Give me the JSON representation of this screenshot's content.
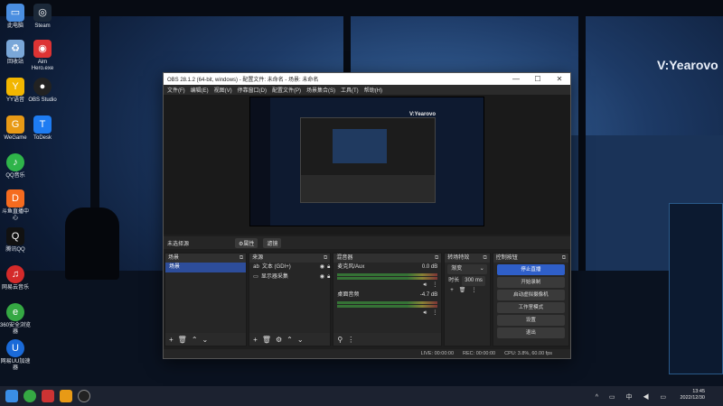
{
  "watermark": "V:Yearovo",
  "desktop_icons": [
    {
      "label": "此电脑",
      "icon": "computer-icon",
      "color": "#4a8ee0"
    },
    {
      "label": "Steam",
      "icon": "steam-icon",
      "color": "#1b2838"
    },
    {
      "label": "回收站",
      "icon": "recycle-bin-icon",
      "color": "#7aa7d8"
    },
    {
      "label": "Aim Hero.exe",
      "icon": "aimhero-icon",
      "color": "#d33"
    },
    {
      "label": "YY语音",
      "icon": "yy-icon",
      "color": "#f2b600"
    },
    {
      "label": "OBS Studio",
      "icon": "obs-icon",
      "color": "#222"
    },
    {
      "label": "WeGame",
      "icon": "wegame-icon",
      "color": "#e89a16"
    },
    {
      "label": "ToDesk",
      "icon": "todesk-icon",
      "color": "#1e7cf2"
    },
    {
      "label": "QQ音乐",
      "icon": "qqmusic-icon",
      "color": "#2fb44a"
    },
    {
      "label": "斗鱼直播中心",
      "icon": "douyu-icon",
      "color": "#f56b1f"
    },
    {
      "label": "腾讯QQ",
      "icon": "qq-icon",
      "color": "#111"
    },
    {
      "label": "网易云音乐",
      "icon": "netease-music-icon",
      "color": "#d42a2a"
    },
    {
      "label": "360安全浏览器",
      "icon": "360-browser-icon",
      "color": "#35a843"
    },
    {
      "label": "网易UU加速器",
      "icon": "uu-accelerator-icon",
      "color": "#1a6ad8"
    }
  ],
  "obs": {
    "title": "OBS 28.1.2 (64-bit, windows) - 配置文件: 未命名 - 场景: 未命名",
    "menu": [
      "文件(F)",
      "编辑(E)",
      "视图(V)",
      "停靠窗口(D)",
      "配置文件(P)",
      "场景集合(S)",
      "工具(T)",
      "帮助(H)"
    ],
    "preview_watermark": "V:Yearovo",
    "scene_bar": {
      "label": "未选择源",
      "props": "⚙属性",
      "filters": "滤镜"
    },
    "scenes": {
      "title": "场景",
      "items": [
        "场景"
      ]
    },
    "sources": {
      "title": "来源",
      "items": [
        "文本 (GDI+)",
        "显示器采集"
      ]
    },
    "mixer": {
      "title": "混音器",
      "tracks": [
        {
          "name": "麦克风/Aux",
          "db": "0.0 dB"
        },
        {
          "name": "桌面音频",
          "db": "-4.7 dB"
        }
      ]
    },
    "transitions": {
      "title": "转场特效",
      "type": "渐变",
      "duration_label": "时长",
      "duration": "300 ms"
    },
    "controls": {
      "title": "控制按钮",
      "buttons": [
        "停止直播",
        "开始录制",
        "启动虚拟摄像机",
        "工作室模式",
        "设置",
        "退出"
      ]
    },
    "status": {
      "live": "LIVE: 00:00:00",
      "rec": "REC: 00:00:00",
      "cpu": "CPU: 3.8%, 60.00 fps"
    }
  },
  "taskbar": {
    "time": "13:45",
    "date": "2022/12/30",
    "tray": "^ ▭ 中 ◀ ▭"
  }
}
